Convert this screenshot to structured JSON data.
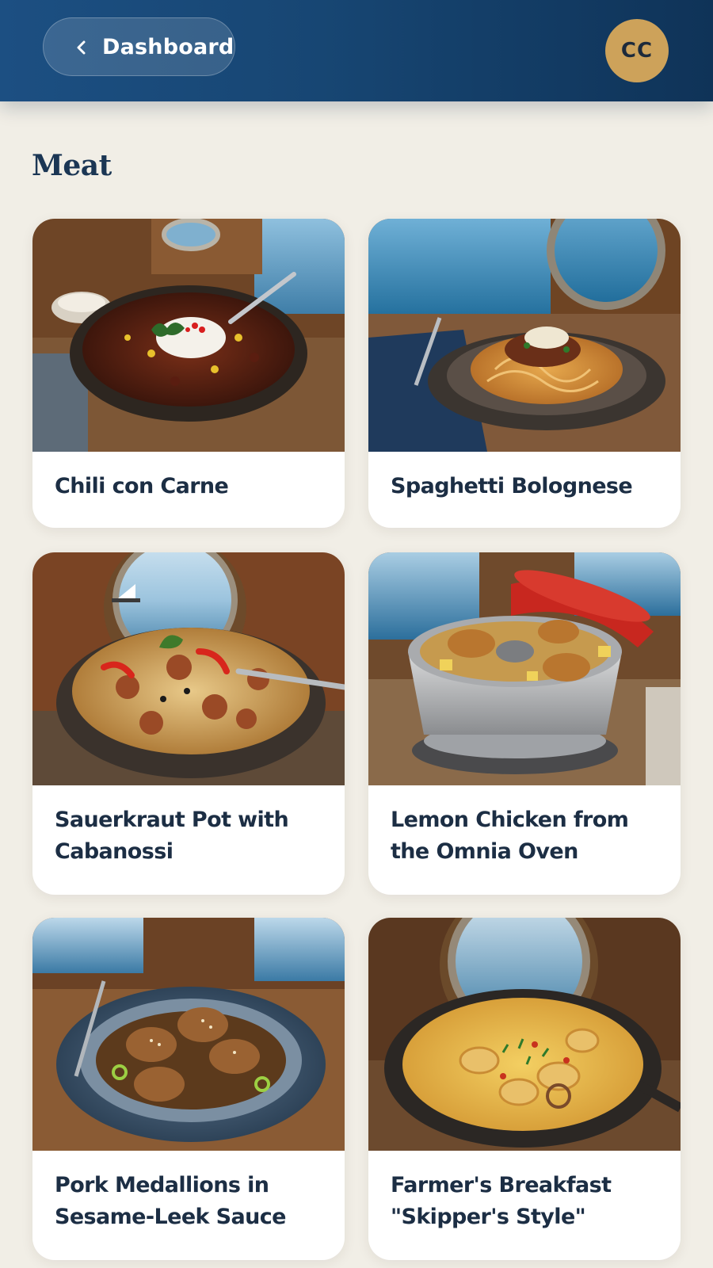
{
  "header": {
    "back_label": "Dashboard",
    "avatar_initials": "CC",
    "colors": {
      "bar": "#174673",
      "avatar": "#cda25a"
    }
  },
  "section": {
    "title": "Meat"
  },
  "recipes": [
    {
      "title": "Chili con Carne",
      "image": "chili-bowl-photo"
    },
    {
      "title": "Spaghetti Bolognese",
      "image": "spaghetti-plate-photo"
    },
    {
      "title": "Sauerkraut Pot with Cabanossi",
      "image": "sauerkraut-pot-photo"
    },
    {
      "title": "Lemon Chicken from the Omnia Oven",
      "image": "lemon-chicken-omnia-photo"
    },
    {
      "title": "Pork Medallions in Sesame-Leek Sauce",
      "image": "pork-medallions-photo"
    },
    {
      "title": "Farmer's Breakfast \"Skipper's Style\"",
      "image": "farmers-breakfast-pan-photo"
    }
  ]
}
